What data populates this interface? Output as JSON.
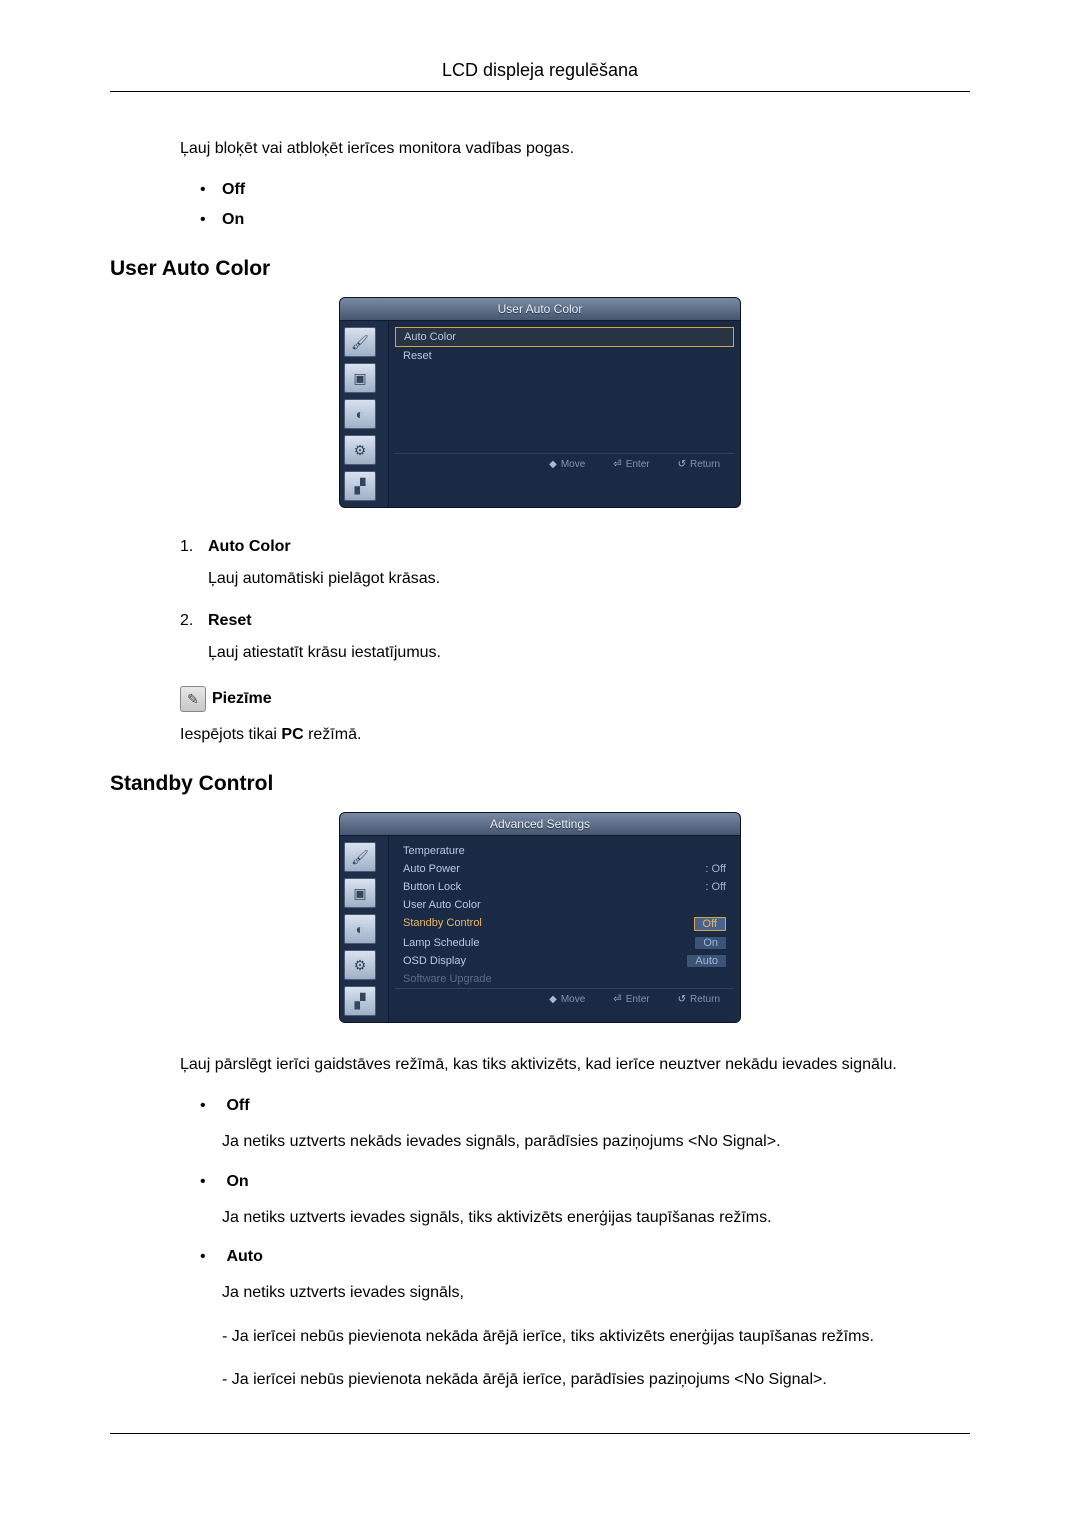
{
  "header": {
    "title": "LCD displeja regulēšana"
  },
  "intro": {
    "text": "Ļauj bloķēt vai atbloķēt ierīces monitora vadības pogas.",
    "bullets": [
      {
        "label": "Off"
      },
      {
        "label": "On"
      }
    ]
  },
  "section1": {
    "heading": "User Auto Color",
    "osd": {
      "title": "User Auto Color",
      "items": [
        {
          "label": "Auto Color",
          "selected": true
        },
        {
          "label": "Reset"
        }
      ],
      "footer": {
        "move": "Move",
        "enter": "Enter",
        "return": "Return"
      }
    },
    "numbered": [
      {
        "num": "1.",
        "label": "Auto Color",
        "desc": "Ļauj automātiski pielāgot krāsas."
      },
      {
        "num": "2.",
        "label": "Reset",
        "desc": "Ļauj atiestatīt krāsu iestatījumus."
      }
    ],
    "note": {
      "label": "Piezīme",
      "text_prefix": "Iespējots tikai ",
      "text_bold": "PC",
      "text_suffix": " režīmā."
    }
  },
  "section2": {
    "heading": "Standby Control",
    "osd": {
      "title": "Advanced Settings",
      "items": [
        {
          "label": "Temperature",
          "value": ""
        },
        {
          "label": "Auto Power",
          "value": ": Off"
        },
        {
          "label": "Button Lock",
          "value": ": Off"
        },
        {
          "label": "User Auto Color",
          "value": ""
        },
        {
          "label": "Standby Control",
          "value": "Off",
          "orange": true,
          "valuesel": true
        },
        {
          "label": "Lamp Schedule",
          "value": "On",
          "valuedim": true
        },
        {
          "label": "OSD Display",
          "value": "Auto",
          "valuedim": true
        },
        {
          "label": "Software Upgrade",
          "value": "",
          "dim": true
        }
      ],
      "footer": {
        "move": "Move",
        "enter": "Enter",
        "return": "Return"
      }
    },
    "desc": "Ļauj pārslēgt ierīci gaidstāves režīmā, kas tiks aktivizēts, kad ierīce neuztver nekādu ievades signālu.",
    "bullets": [
      {
        "label": "Off",
        "lines": [
          {
            "t": "Ja netiks uztverts nekāds ievades signāls, parādīsies paziņojums <No Signal>."
          }
        ]
      },
      {
        "label": "On",
        "lines": [
          {
            "t": "Ja netiks uztverts ievades signāls, tiks aktivizēts enerģijas taupīšanas režīms."
          }
        ]
      },
      {
        "label": "Auto",
        "lines": [
          {
            "t": "Ja netiks uztverts ievades signāls,"
          },
          {
            "t": "- Ja ierīcei nebūs pievienota nekāda ārējā ierīce, tiks aktivizēts enerģijas taupīšanas režīms."
          },
          {
            "t": "- Ja ierīcei nebūs pievienota nekāda ārējā ierīce, parādīsies paziņojums <No Signal>."
          }
        ]
      }
    ]
  }
}
